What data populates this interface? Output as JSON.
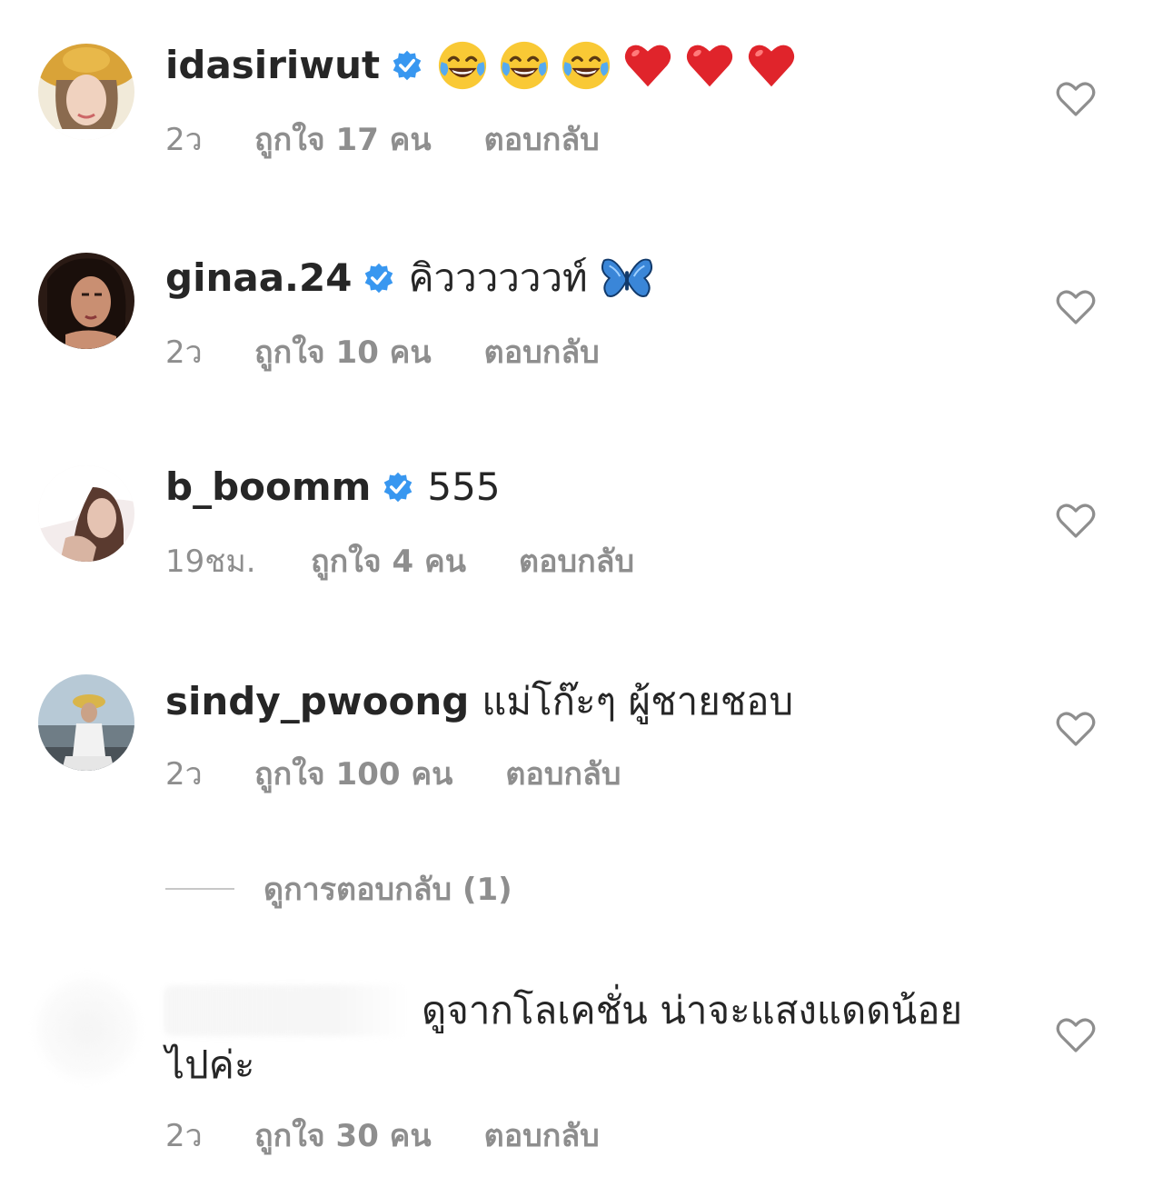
{
  "comments": [
    {
      "username": "idasiriwut",
      "verified": true,
      "text": "",
      "emojis": [
        "laughing-tears",
        "laughing-tears",
        "laughing-tears",
        "red-heart",
        "red-heart",
        "red-heart"
      ],
      "time": "2ว",
      "likes": "ถูกใจ 17 คน",
      "reply": "ตอบกลับ"
    },
    {
      "username": "ginaa.24",
      "verified": true,
      "text": "คิววววววท์",
      "emojis": [
        "blue-butterfly"
      ],
      "time": "2ว",
      "likes": "ถูกใจ 10 คน",
      "reply": "ตอบกลับ"
    },
    {
      "username": "b_boomm",
      "verified": true,
      "text": "555",
      "emojis": [],
      "time": "19ชม.",
      "likes": "ถูกใจ 4 คน",
      "reply": "ตอบกลับ"
    },
    {
      "username": "sindy_pwoong",
      "verified": false,
      "text": "แม่โก๊ะๆ ผู้ชายชอบ",
      "emojis": [],
      "time": "2ว",
      "likes": "ถูกใจ 100 คน",
      "reply": "ตอบกลับ"
    },
    {
      "username": "",
      "verified": false,
      "text": "ดูจากโลเคชั่น น่าจะแสงแดดน้อยไปค่ะ",
      "emojis": [],
      "time": "2ว",
      "likes": "ถูกใจ 30 คน",
      "reply": "ตอบกลับ"
    }
  ],
  "view_replies": "ดูการตอบกลับ (1)",
  "icons": {
    "verified_color": "#3897f0",
    "heart_outline_color": "#8e8e8e"
  }
}
